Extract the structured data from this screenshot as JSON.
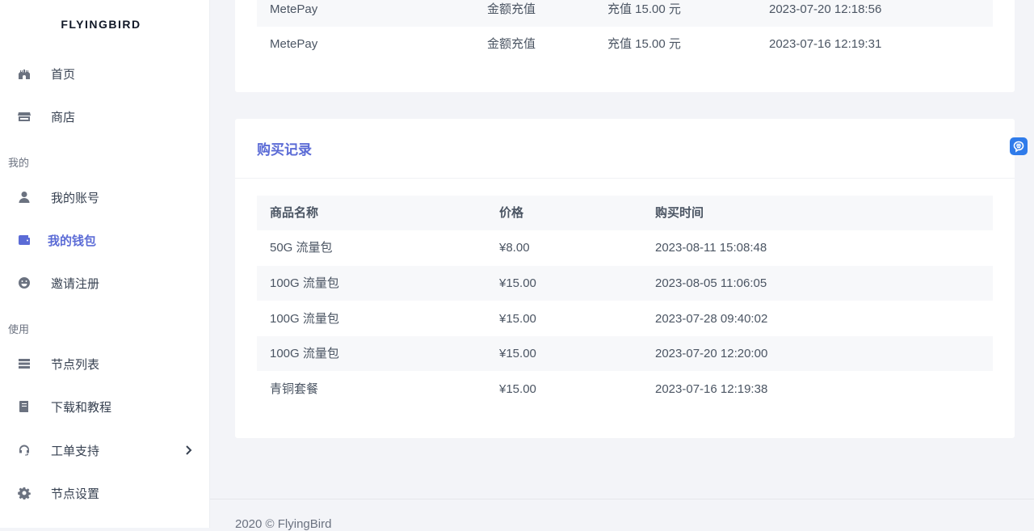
{
  "sidebar": {
    "brand": "FLYINGBIRD",
    "items": [
      {
        "label": "首页"
      },
      {
        "label": "商店"
      },
      {
        "label": "我的账号"
      },
      {
        "label": "我的钱包"
      },
      {
        "label": "邀请注册"
      },
      {
        "label": "节点列表"
      },
      {
        "label": "下载和教程"
      },
      {
        "label": "工单支持"
      },
      {
        "label": "节点设置"
      }
    ],
    "sections": {
      "mine": "我的",
      "use": "使用"
    }
  },
  "recharge_records": {
    "rows": [
      {
        "method": "MetePay",
        "type": "金额充值",
        "amount": "充值 15.00 元",
        "time": "2023-07-20 12:18:56"
      },
      {
        "method": "MetePay",
        "type": "金额充值",
        "amount": "充值 15.00 元",
        "time": "2023-07-16 12:19:31"
      }
    ]
  },
  "purchase_records": {
    "title": "购买记录",
    "headers": {
      "name": "商品名称",
      "price": "价格",
      "time": "购买时间"
    },
    "rows": [
      {
        "name": "50G 流量包",
        "price": "¥8.00",
        "time": "2023-08-11 15:08:48"
      },
      {
        "name": "100G 流量包",
        "price": "¥15.00",
        "time": "2023-08-05 11:06:05"
      },
      {
        "name": "100G 流量包",
        "price": "¥15.00",
        "time": "2023-07-28 09:40:02"
      },
      {
        "name": "100G 流量包",
        "price": "¥15.00",
        "time": "2023-07-20 12:20:00"
      },
      {
        "name": "青铜套餐",
        "price": "¥15.00",
        "time": "2023-07-16 12:19:38"
      }
    ]
  },
  "footer": {
    "text": "2020 © FlyingBird"
  },
  "colors": {
    "accent": "#5b6bd6",
    "float_button": "#2f7bea"
  }
}
